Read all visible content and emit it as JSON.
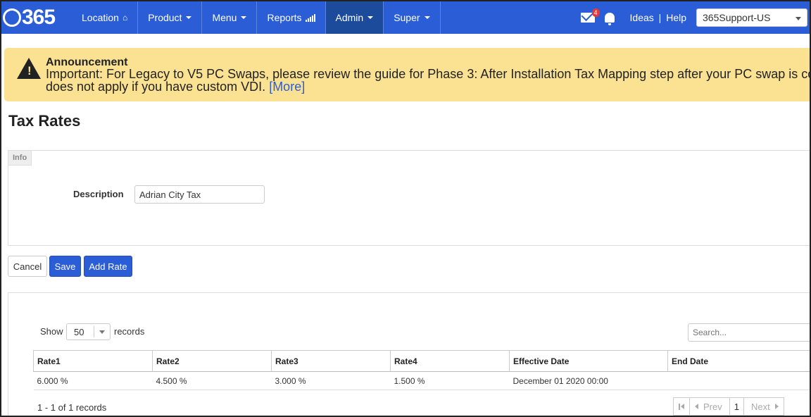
{
  "navbar": {
    "logo": "365",
    "items": [
      {
        "label": "Location",
        "icon": "home-icon"
      },
      {
        "label": "Product",
        "icon": "caret-down-icon"
      },
      {
        "label": "Menu",
        "icon": "caret-down-icon"
      },
      {
        "label": "Reports",
        "icon": "signal-bars-icon"
      },
      {
        "label": "Admin",
        "icon": "caret-down-icon",
        "active": true
      },
      {
        "label": "Super",
        "icon": "caret-down-icon"
      }
    ],
    "notification_count": "4",
    "ideas_label": "Ideas",
    "separator": "|",
    "help_label": "Help",
    "account": "365Support-US"
  },
  "announcement": {
    "title": "Announcement",
    "text": "Important: For Legacy to V5 PC Swaps, please review the guide for Phase 3: After Installation Tax Mapping step after your PC swap is complete. This does not apply if you have custom VDI.",
    "more_label": "[More]"
  },
  "page": {
    "title": "Tax Rates"
  },
  "info_panel": {
    "tag": "Info",
    "description_label": "Description",
    "description_value": "Adrian City Tax"
  },
  "actions": {
    "cancel": "Cancel",
    "save": "Save",
    "add_rate": "Add Rate"
  },
  "table_controls": {
    "show_label": "Show",
    "page_length": "50",
    "records_label": "records",
    "search_placeholder": "Search..."
  },
  "table": {
    "columns": [
      "Rate1",
      "Rate2",
      "Rate3",
      "Rate4",
      "Effective Date",
      "End Date"
    ],
    "rows": [
      [
        "6.000 %",
        "4.500 %",
        "3.000 %",
        "1.500 %",
        "December 01 2020 00:00",
        ""
      ]
    ]
  },
  "footer": {
    "info": "1 - 1 of 1 records",
    "prev": "Prev",
    "current_page": "1",
    "next": "Next"
  },
  "colors": {
    "nav_bg": "#2a5dd6",
    "announcement_bg": "#fbe293",
    "primary": "#2a5dd6"
  }
}
